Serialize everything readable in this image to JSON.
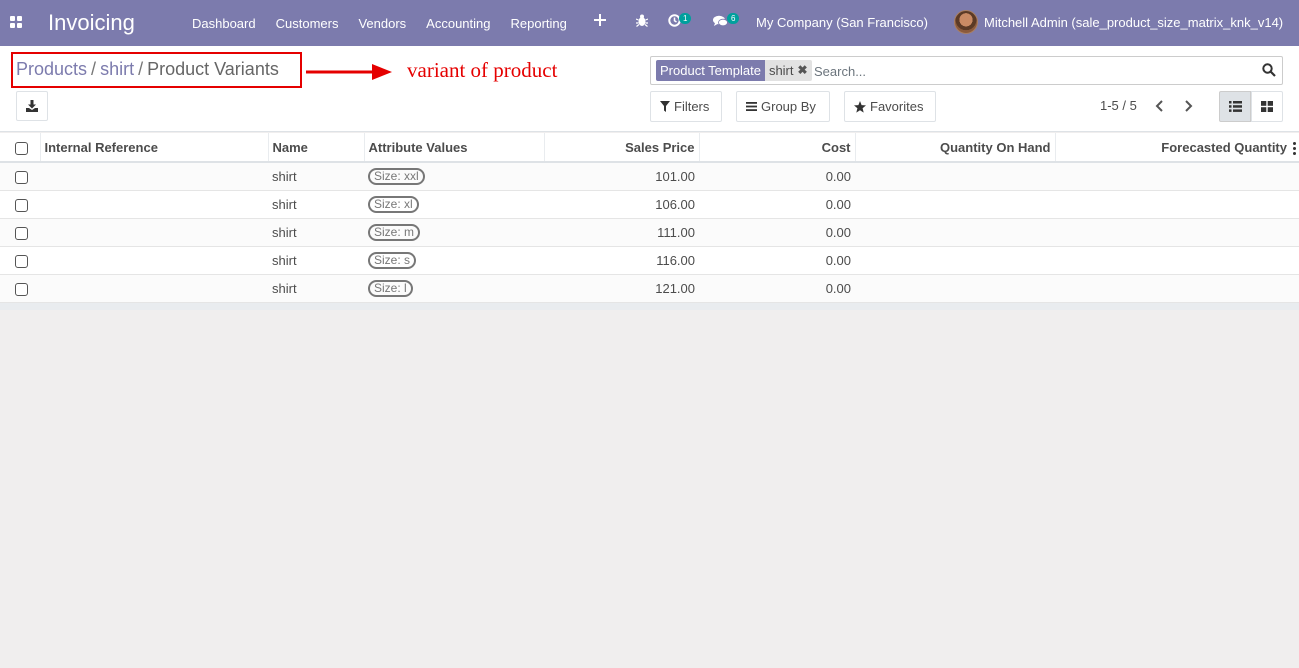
{
  "navbar": {
    "brand": "Invoicing",
    "menu": [
      "Dashboard",
      "Customers",
      "Vendors",
      "Accounting",
      "Reporting"
    ],
    "activity_count": "1",
    "messages_count": "6",
    "company": "My Company (San Francisco)",
    "user": "Mitchell Admin (sale_product_size_matrix_knk_v14)",
    "bg_color": "#7c7bad"
  },
  "breadcrumb": {
    "items": [
      "Products",
      "shirt"
    ],
    "current": "Product Variants"
  },
  "annotation": {
    "text": "variant of product",
    "color": "#e50000"
  },
  "search": {
    "facet_label": "Product Template",
    "facet_value": "shirt",
    "placeholder": "Search..."
  },
  "filters": {
    "filters_label": "Filters",
    "groupby_label": "Group By",
    "favorites_label": "Favorites"
  },
  "pager": {
    "value": "1-5 / 5"
  },
  "table": {
    "columns": [
      "Internal Reference",
      "Name",
      "Attribute Values",
      "Sales Price",
      "Cost",
      "Quantity On Hand",
      "Forecasted Quantity"
    ],
    "rows": [
      {
        "ref": "",
        "name": "shirt",
        "attr": "Size: xxl",
        "price": "101.00",
        "cost": "0.00",
        "qty": "",
        "forecast": ""
      },
      {
        "ref": "",
        "name": "shirt",
        "attr": "Size: xl",
        "price": "106.00",
        "cost": "0.00",
        "qty": "",
        "forecast": ""
      },
      {
        "ref": "",
        "name": "shirt",
        "attr": "Size: m",
        "price": "111.00",
        "cost": "0.00",
        "qty": "",
        "forecast": ""
      },
      {
        "ref": "",
        "name": "shirt",
        "attr": "Size: s",
        "price": "116.00",
        "cost": "0.00",
        "qty": "",
        "forecast": ""
      },
      {
        "ref": "",
        "name": "shirt",
        "attr": "Size: l",
        "price": "121.00",
        "cost": "0.00",
        "qty": "",
        "forecast": ""
      }
    ]
  }
}
